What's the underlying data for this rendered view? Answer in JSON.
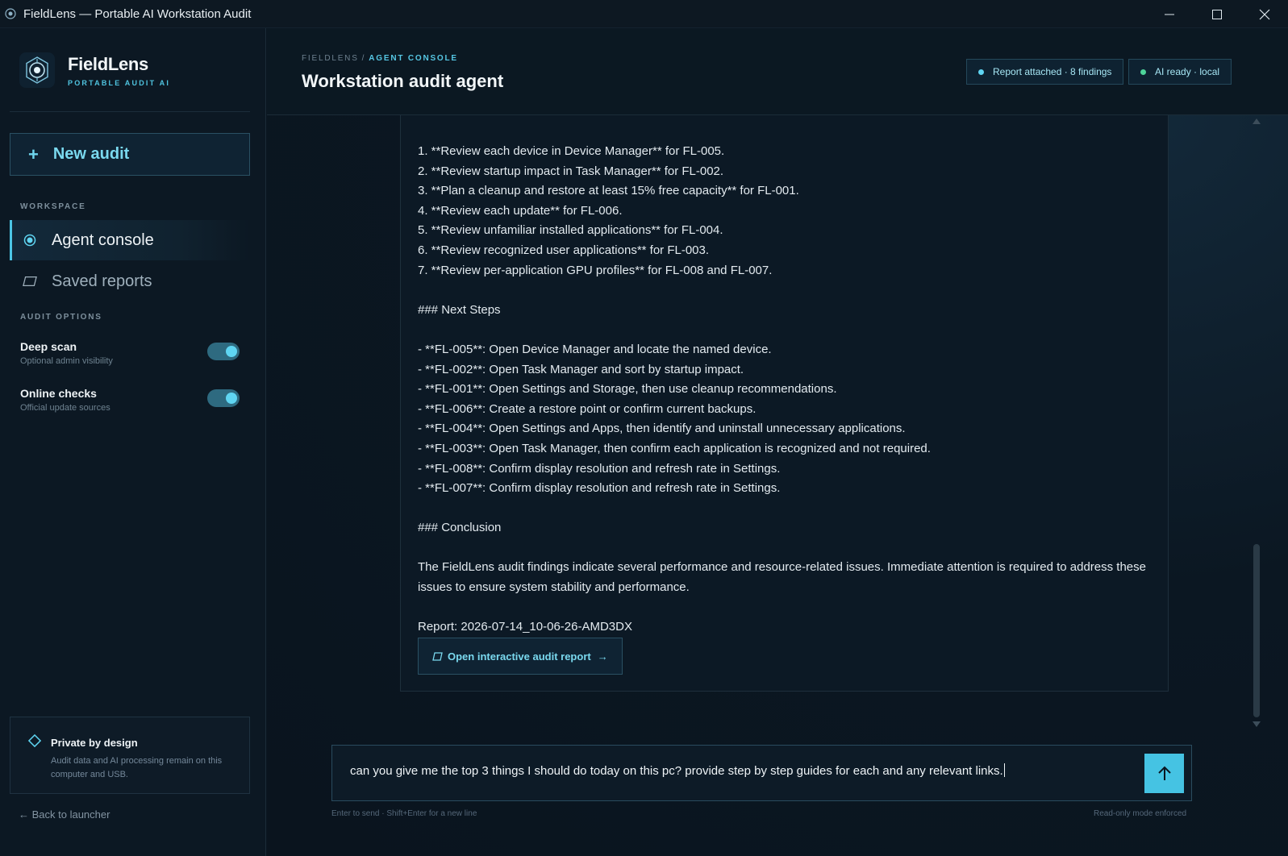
{
  "window": {
    "title": "FieldLens — Portable AI Workstation Audit"
  },
  "brand": {
    "name": "FieldLens",
    "subtitle": "PORTABLE AUDIT AI"
  },
  "sidebar": {
    "new_audit_label": "New audit",
    "workspace_label": "WORKSPACE",
    "nav": [
      {
        "label": "Agent console",
        "icon": "radio-dot-icon",
        "active": true
      },
      {
        "label": "Saved reports",
        "icon": "report-icon",
        "active": false
      }
    ],
    "audit_options_label": "AUDIT OPTIONS",
    "options": [
      {
        "title": "Deep scan",
        "subtitle": "Optional admin visibility",
        "enabled": true
      },
      {
        "title": "Online checks",
        "subtitle": "Official update sources",
        "enabled": true
      }
    ],
    "privacy": {
      "title": "Private by design",
      "text": "Audit data and AI processing remain on this computer and USB."
    },
    "back_label": "← Back to launcher"
  },
  "header": {
    "breadcrumb_root": "FIELDLENS",
    "breadcrumb_separator": "/",
    "breadcrumb_current": "AGENT CONSOLE",
    "title": "Workstation audit agent",
    "chips": [
      {
        "label": "Report attached · 8 findings",
        "dot_color": "#5fd5f2"
      },
      {
        "label": "AI ready · local",
        "dot_color": "#4ed49a"
      }
    ]
  },
  "message": {
    "steps": [
      "1. **Review each device in Device Manager** for FL-005.",
      "2. **Review startup impact in Task Manager** for FL-002.",
      "3. **Plan a cleanup and restore at least 15% free capacity** for FL-001.",
      "4. **Review each update** for FL-006.",
      "5. **Review unfamiliar installed applications** for FL-004.",
      "6. **Review recognized user applications** for FL-003.",
      "7. **Review per-application GPU profiles** for FL-008 and FL-007."
    ],
    "next_steps_heading": "### Next Steps",
    "next_steps": [
      "- **FL-005**: Open Device Manager and locate the named device.",
      "- **FL-002**: Open Task Manager and sort by startup impact.",
      "- **FL-001**: Open Settings and Storage, then use cleanup recommendations.",
      "- **FL-006**: Create a restore point or confirm current backups.",
      "- **FL-004**: Open Settings and Apps, then identify and uninstall unnecessary applications.",
      "- **FL-003**: Open Task Manager, then confirm each application is recognized and not required.",
      "- **FL-008**: Confirm display resolution and refresh rate in Settings.",
      "- **FL-007**: Confirm display resolution and refresh rate in Settings."
    ],
    "conclusion_heading": "### Conclusion",
    "conclusion_text": "The FieldLens audit findings indicate several performance and resource-related issues. Immediate attention is required to address these issues to ensure system stability and performance.",
    "report_line": "Report: 2026-07-14_10-06-26-AMD3DX",
    "report_button_label": "Open interactive audit report",
    "report_button_arrow": "→"
  },
  "composer": {
    "value": "can you give me the top 3 things I should do today on this pc? provide step by step guides for each and any relevant links.",
    "hint_left": "Enter to send · Shift+Enter for a new line",
    "hint_right": "Read-only mode enforced"
  },
  "colors": {
    "accent": "#45c3e3",
    "background": "#0a1520",
    "ready_dot": "#4ed49a"
  }
}
